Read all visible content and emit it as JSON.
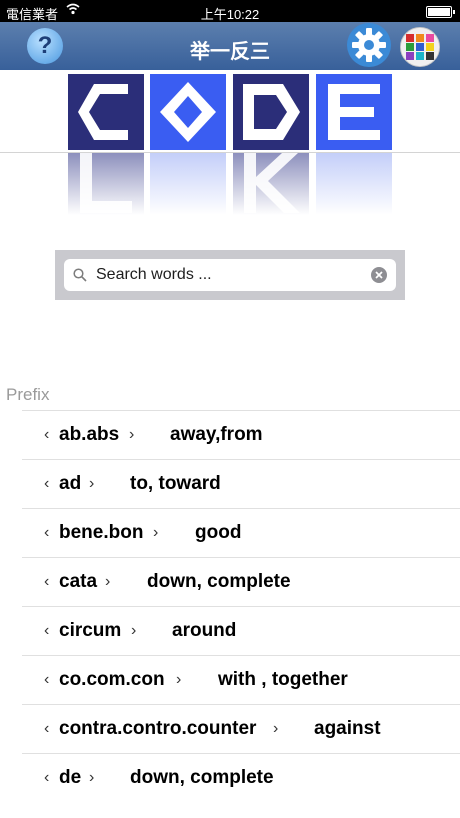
{
  "status_bar": {
    "carrier": "電信業者",
    "time": "上午10:22"
  },
  "nav": {
    "title": "举一反三",
    "help_label": "?"
  },
  "search": {
    "placeholder": "Search words ..."
  },
  "section": {
    "header": "Prefix"
  },
  "rows": [
    {
      "prefix": "ab.abs",
      "meaning": "away,from"
    },
    {
      "prefix": "ad",
      "meaning": "to, toward"
    },
    {
      "prefix": "bene.bon",
      "meaning": "good"
    },
    {
      "prefix": "cata",
      "meaning": "down, complete"
    },
    {
      "prefix": "circum",
      "meaning": "around"
    },
    {
      "prefix": "co.com.con",
      "meaning": "with , together"
    },
    {
      "prefix": "contra.contro.counter",
      "meaning": "against"
    },
    {
      "prefix": "de",
      "meaning": "down, complete"
    }
  ],
  "logo": {
    "letters": [
      "C",
      "O",
      "D",
      "E"
    ],
    "reflection_letters": [
      "L",
      "K"
    ]
  },
  "colors": {
    "nav": "#38609a",
    "tile_dark": "#2b2e79",
    "tile_bright": "#3a5df2"
  }
}
